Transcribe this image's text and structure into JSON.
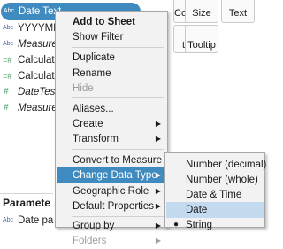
{
  "data_pane": {
    "fields": [
      {
        "icon": "Abc",
        "label": "Date Text",
        "italic": false
      },
      {
        "icon": "Abc",
        "label": "YYYYMM",
        "italic": false
      },
      {
        "icon": "Abc",
        "label": "Measure",
        "italic": true
      },
      {
        "icon": "=#",
        "label": "Calculat",
        "italic": false
      },
      {
        "icon": "=#",
        "label": "Calculat",
        "italic": false
      },
      {
        "icon": "#",
        "label": "DateTes",
        "italic": true
      },
      {
        "icon": "#",
        "label": "Measure",
        "italic": true
      }
    ],
    "parameters_heading": "Paramete",
    "parameter_items": [
      {
        "icon": "Abc",
        "label": "Date pa"
      }
    ]
  },
  "show_me": {
    "cards": [
      "Colour",
      "Size",
      "Text",
      "tail",
      "Tooltip"
    ]
  },
  "context_menu": {
    "items": [
      {
        "label": "Add to Sheet",
        "bold": true
      },
      {
        "label": "Show Filter"
      },
      {
        "label": "Duplicate"
      },
      {
        "label": "Rename"
      },
      {
        "label": "Hide",
        "disabled": true
      },
      {
        "label": "Aliases..."
      },
      {
        "label": "Create",
        "submenu": true
      },
      {
        "label": "Transform",
        "submenu": true
      },
      {
        "label": "Convert to Measure"
      },
      {
        "label": "Change Data Type",
        "submenu": true,
        "highlighted": true
      },
      {
        "label": "Geographic Role",
        "submenu": true
      },
      {
        "label": "Default Properties",
        "submenu": true
      },
      {
        "label": "Group by",
        "submenu": true
      },
      {
        "label": "Folders",
        "submenu": true,
        "disabled": true
      }
    ],
    "submenu_arrow": "▶"
  },
  "data_type_submenu": {
    "items": [
      {
        "label": "Number (decimal)"
      },
      {
        "label": "Number (whole)"
      },
      {
        "label": "Date & Time"
      },
      {
        "label": "Date",
        "hovered": true
      },
      {
        "label": "String",
        "selected": true
      }
    ],
    "selected_marker": "●"
  },
  "colors": {
    "selection_blue": "#3f8abf",
    "hover_light_blue": "#c4daef",
    "menu_bg": "#f2f2f2",
    "disabled_text": "#9d9d9d"
  }
}
